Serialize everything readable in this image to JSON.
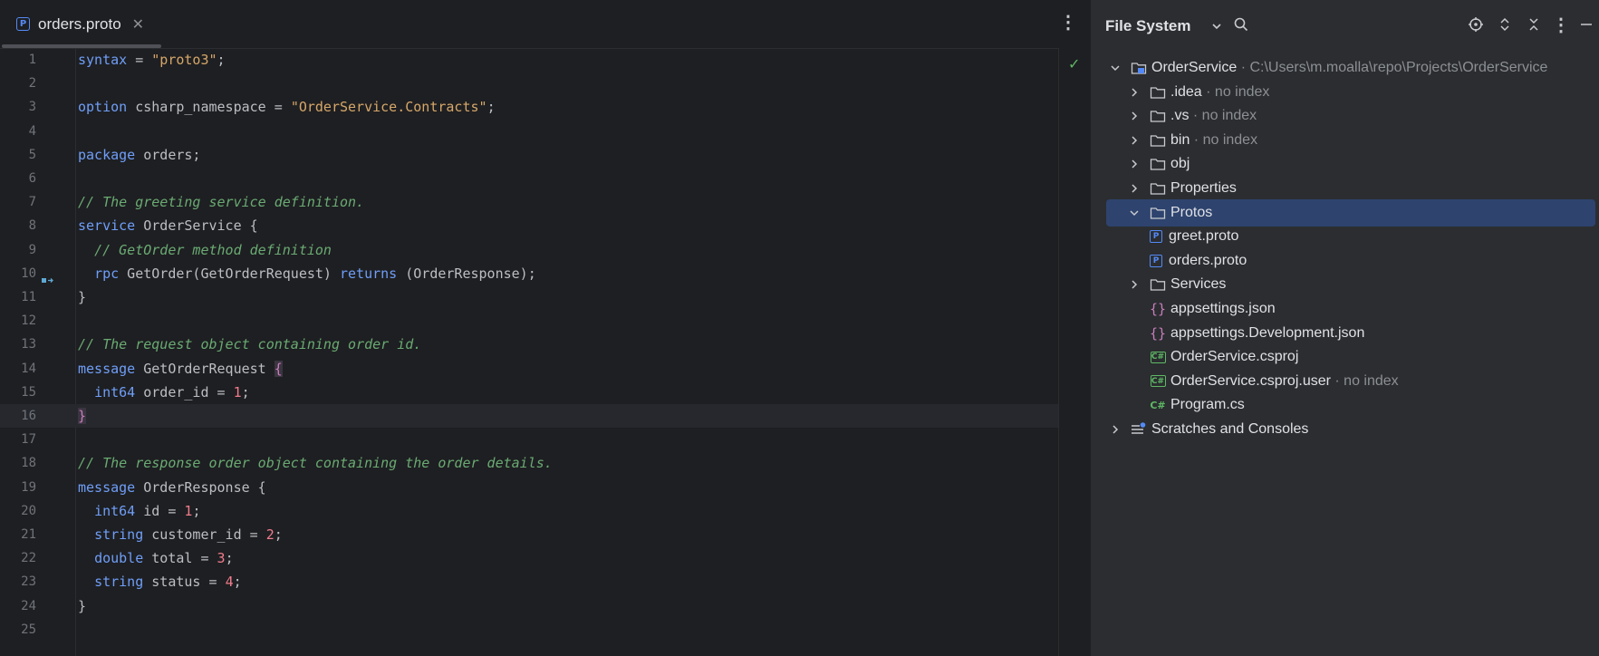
{
  "editor": {
    "tab": {
      "label": "orders.proto",
      "icon": "proto-file-icon",
      "badge": "P"
    },
    "check_icon": "✓",
    "lines": [
      {
        "n": "1",
        "seg": [
          [
            "kw",
            "syntax"
          ],
          [
            "",
            "&nbsp;= "
          ],
          [
            "str",
            "\"proto3\""
          ],
          [
            "",
            ";"
          ]
        ]
      },
      {
        "n": "2",
        "seg": []
      },
      {
        "n": "3",
        "seg": [
          [
            "kw",
            "option"
          ],
          [
            "",
            " csharp_namespace = "
          ],
          [
            "str",
            "\"OrderService.Contracts\""
          ],
          [
            "",
            ";"
          ]
        ]
      },
      {
        "n": "4",
        "seg": []
      },
      {
        "n": "5",
        "seg": [
          [
            "kw",
            "package"
          ],
          [
            "",
            " orders;"
          ]
        ]
      },
      {
        "n": "6",
        "seg": []
      },
      {
        "n": "7",
        "seg": [
          [
            "cm",
            "// The greeting service definition."
          ]
        ]
      },
      {
        "n": "8",
        "seg": [
          [
            "kw",
            "service"
          ],
          [
            "",
            " OrderService {"
          ]
        ]
      },
      {
        "n": "9",
        "seg": [
          [
            "",
            "  "
          ],
          [
            "cm",
            "// GetOrder method definition"
          ]
        ]
      },
      {
        "n": "10",
        "seg": [
          [
            "",
            "  "
          ],
          [
            "kw",
            "rpc"
          ],
          [
            "",
            " GetOrder(GetOrderRequest) "
          ],
          [
            "kw",
            "returns"
          ],
          [
            "",
            " (OrderResponse);"
          ]
        ]
      },
      {
        "n": "11",
        "seg": [
          [
            "",
            "}"
          ]
        ]
      },
      {
        "n": "12",
        "seg": []
      },
      {
        "n": "13",
        "seg": [
          [
            "cm",
            "// The request object containing order id."
          ]
        ]
      },
      {
        "n": "14",
        "seg": [
          [
            "kw",
            "message"
          ],
          [
            "",
            " GetOrderRequest "
          ],
          [
            "brace-hl",
            "{"
          ]
        ]
      },
      {
        "n": "15",
        "seg": [
          [
            "",
            "  "
          ],
          [
            "kw",
            "int64"
          ],
          [
            "",
            " order_id = "
          ],
          [
            "num",
            "1"
          ],
          [
            "",
            ";"
          ]
        ]
      },
      {
        "n": "16",
        "seg": [
          [
            "brace-hl",
            "}"
          ]
        ]
      },
      {
        "n": "17",
        "seg": []
      },
      {
        "n": "18",
        "seg": [
          [
            "cm",
            "// The response order object containing the order details."
          ]
        ]
      },
      {
        "n": "19",
        "seg": [
          [
            "kw",
            "message"
          ],
          [
            "",
            " OrderResponse {"
          ]
        ]
      },
      {
        "n": "20",
        "seg": [
          [
            "",
            "  "
          ],
          [
            "kw",
            "int64"
          ],
          [
            "",
            " id = "
          ],
          [
            "num",
            "1"
          ],
          [
            "",
            ";"
          ]
        ]
      },
      {
        "n": "21",
        "seg": [
          [
            "",
            "  "
          ],
          [
            "kw",
            "string"
          ],
          [
            "",
            " customer_id = "
          ],
          [
            "num",
            "2"
          ],
          [
            "",
            ";"
          ]
        ]
      },
      {
        "n": "22",
        "seg": [
          [
            "",
            "  "
          ],
          [
            "kw",
            "double"
          ],
          [
            "",
            " total = "
          ],
          [
            "num",
            "3"
          ],
          [
            "",
            ";"
          ]
        ]
      },
      {
        "n": "23",
        "seg": [
          [
            "",
            "  "
          ],
          [
            "kw",
            "string"
          ],
          [
            "",
            " status = "
          ],
          [
            "num",
            "4"
          ],
          [
            "",
            ";"
          ]
        ]
      },
      {
        "n": "24",
        "seg": [
          [
            "",
            "}"
          ]
        ]
      },
      {
        "n": "25",
        "seg": []
      }
    ]
  },
  "panel": {
    "title": "File System",
    "tree": [
      {
        "label": "OrderService",
        "hint": "· C:\\Users\\m.moalla\\repo\\Projects\\OrderService",
        "level": 0,
        "expanded": true,
        "icon": "project-folder-icon"
      },
      {
        "label": ".idea",
        "hint": "· no index",
        "level": 1,
        "expanded": false,
        "icon": "folder-icon"
      },
      {
        "label": ".vs",
        "hint": "· no index",
        "level": 1,
        "expanded": false,
        "icon": "folder-icon"
      },
      {
        "label": "bin",
        "hint": "· no index",
        "level": 1,
        "expanded": false,
        "icon": "folder-icon"
      },
      {
        "label": "obj",
        "hint": "",
        "level": 1,
        "expanded": false,
        "icon": "folder-icon"
      },
      {
        "label": "Properties",
        "hint": "",
        "level": 1,
        "expanded": false,
        "icon": "folder-icon"
      },
      {
        "label": "Protos",
        "hint": "",
        "level": 1,
        "expanded": true,
        "icon": "folder-icon",
        "selected": true
      },
      {
        "label": "greet.proto",
        "hint": "",
        "level": 2,
        "icon": "proto-file-icon"
      },
      {
        "label": "orders.proto",
        "hint": "",
        "level": 2,
        "icon": "proto-file-icon"
      },
      {
        "label": "Services",
        "hint": "",
        "level": 1,
        "expanded": false,
        "icon": "folder-icon"
      },
      {
        "label": "appsettings.json",
        "hint": "",
        "level": 1,
        "icon": "json-file-icon"
      },
      {
        "label": "appsettings.Development.json",
        "hint": "",
        "level": 1,
        "icon": "json-file-icon"
      },
      {
        "label": "OrderService.csproj",
        "hint": "",
        "level": 1,
        "icon": "csproj-file-icon"
      },
      {
        "label": "OrderService.csproj.user",
        "hint": "· no index",
        "level": 1,
        "icon": "csproj-file-icon"
      },
      {
        "label": "Program.cs",
        "hint": "",
        "level": 1,
        "icon": "csharp-file-icon"
      },
      {
        "label": "Scratches and Consoles",
        "hint": "",
        "level": 0,
        "expanded": false,
        "icon": "scratches-icon"
      }
    ]
  }
}
